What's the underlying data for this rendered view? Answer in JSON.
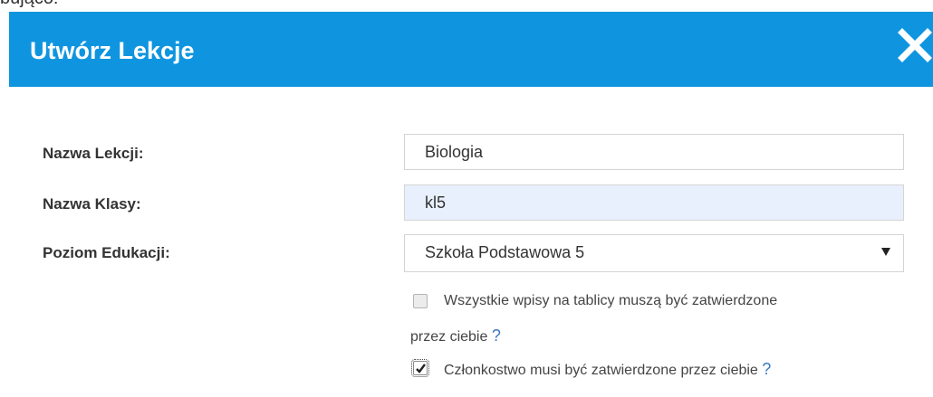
{
  "background_text": "bująco:",
  "dialog": {
    "title": "Utwórz Lekcje",
    "close_icon": "close-icon",
    "header_color": "#0f95e0"
  },
  "form": {
    "lesson_name": {
      "label": "Nazwa Lekcji:",
      "value": "Biologia"
    },
    "class_name": {
      "label": "Nazwa Klasy:",
      "value": "kl5"
    },
    "education_level": {
      "label": "Poziom Edukacji:",
      "selected": "Szkoła Podstawowa 5"
    },
    "approve_posts": {
      "checked": false,
      "label_line1": "Wszystkie wpisy na tablicy muszą być zatwierdzone",
      "label_line2": "przez ciebie",
      "help": "?"
    },
    "approve_membership": {
      "checked": true,
      "label": "Członkostwo musi być zatwierdzone przez ciebie",
      "help": "?"
    }
  }
}
